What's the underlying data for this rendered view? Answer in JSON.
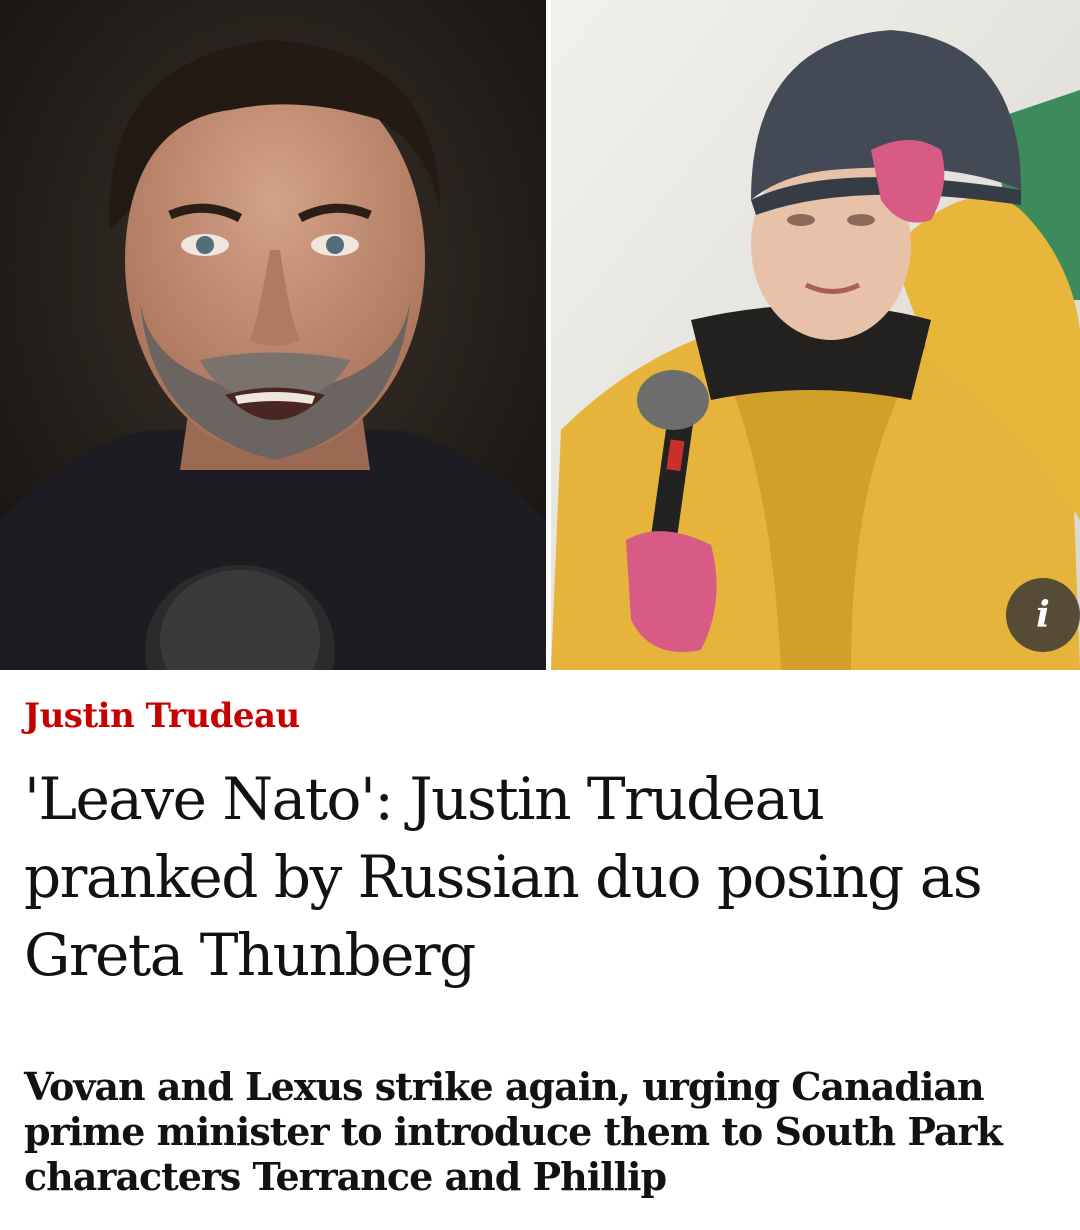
{
  "article": {
    "kicker": "Justin Trudeau",
    "headline": "'Leave Nato': Justin Trudeau pranked by Russian duo posing as Greta Thunberg",
    "standfirst": "Vovan and Lexus strike again, urging Canadian prime minister to introduce them to South Park characters Terrance and Phillip"
  },
  "media": {
    "info_glyph": "i",
    "info_icon": "info-icon",
    "kicker_color": "#c70000",
    "text_color": "#121212"
  }
}
